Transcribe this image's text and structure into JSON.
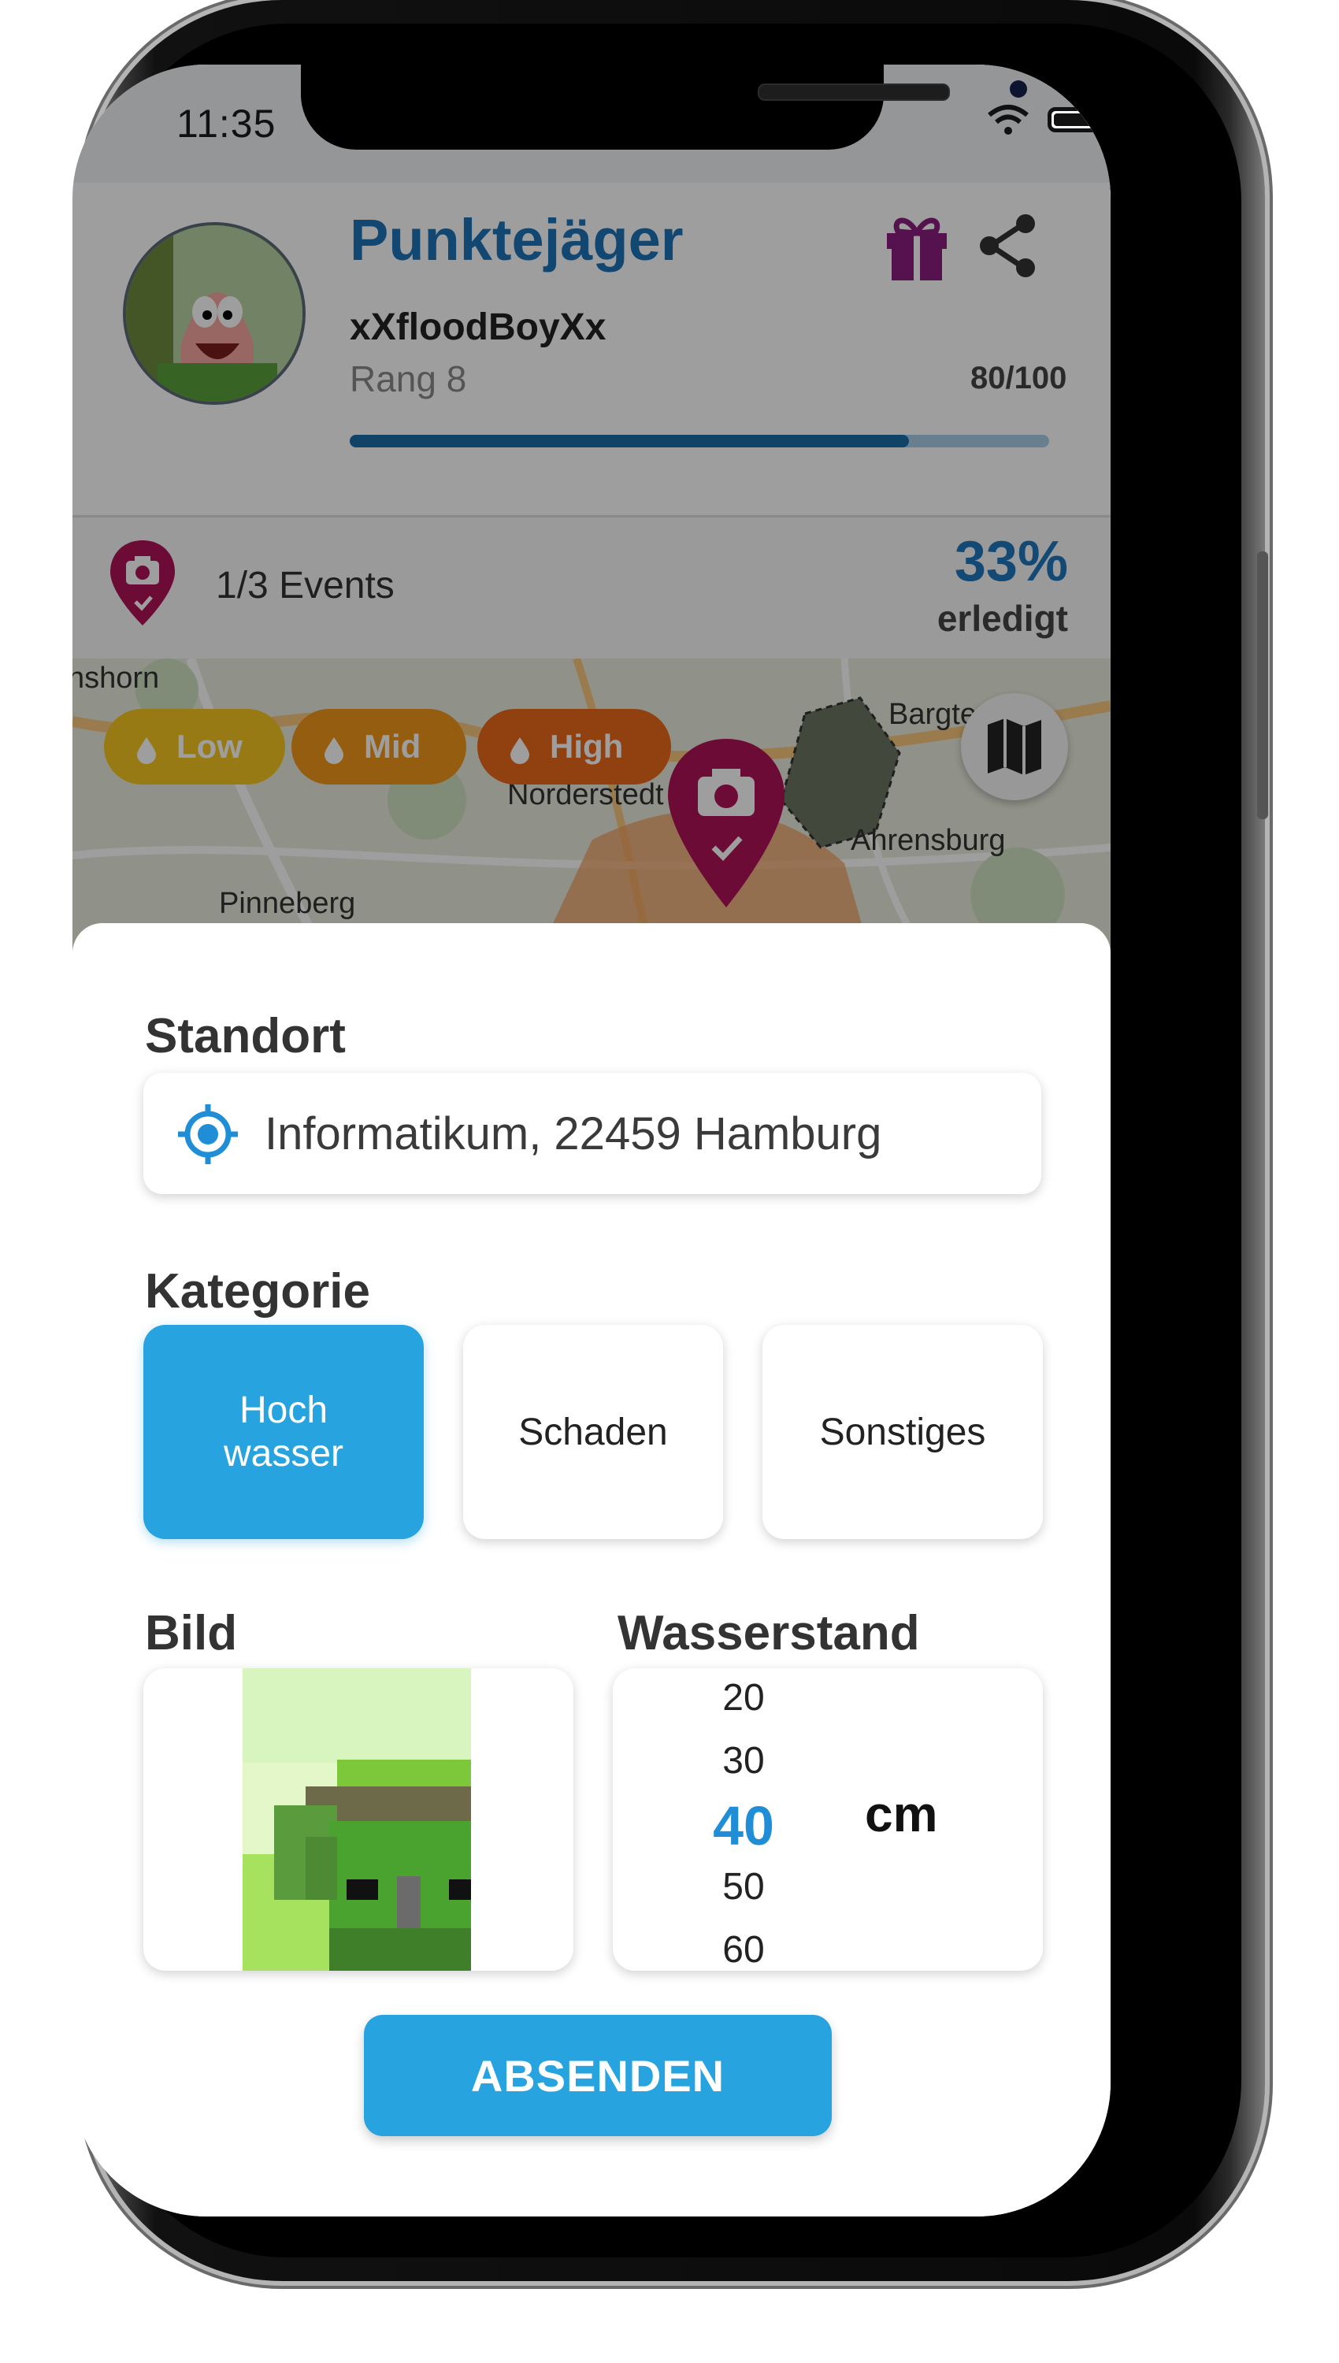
{
  "status": {
    "time": "11:35"
  },
  "header": {
    "title": "Punktejäger",
    "username": "xXfloodBoyXx",
    "rank": "Rang 8",
    "points": "80/100",
    "progress_fraction": 0.8
  },
  "events": {
    "label": "1/3 Events",
    "percent": "33%",
    "done_label": "erledigt"
  },
  "map": {
    "labels": {
      "nshorn": "nshorn",
      "bargt": "Bargte",
      "norderstedt": "Norderstedt",
      "ahrensburg": "Ahrensburg",
      "pinneberg": "Pinneberg"
    },
    "filters": [
      "Low",
      "Mid",
      "High"
    ],
    "colors": {
      "low": "#f6c521",
      "mid": "#f0961b",
      "high": "#ea6a1a",
      "pin": "#b0135a"
    }
  },
  "form": {
    "location_label": "Standort",
    "location_value": "Informatikum, 22459 Hamburg",
    "category_label": "Kategorie",
    "categories": [
      {
        "line1": "Hoch",
        "line2": "wasser",
        "selected": true
      },
      {
        "label": "Schaden",
        "selected": false
      },
      {
        "label": "Sonstiges",
        "selected": false
      }
    ],
    "image_label": "Bild",
    "level_label": "Wasserstand",
    "level_values": [
      "20",
      "30",
      "40",
      "50",
      "60"
    ],
    "level_selected": "40",
    "level_unit": "cm",
    "submit_label": "ABSENDEN"
  },
  "colors": {
    "accent": "#27a3e0",
    "title_blue": "#1e73b8",
    "gift_purple": "#8b1e7e"
  }
}
